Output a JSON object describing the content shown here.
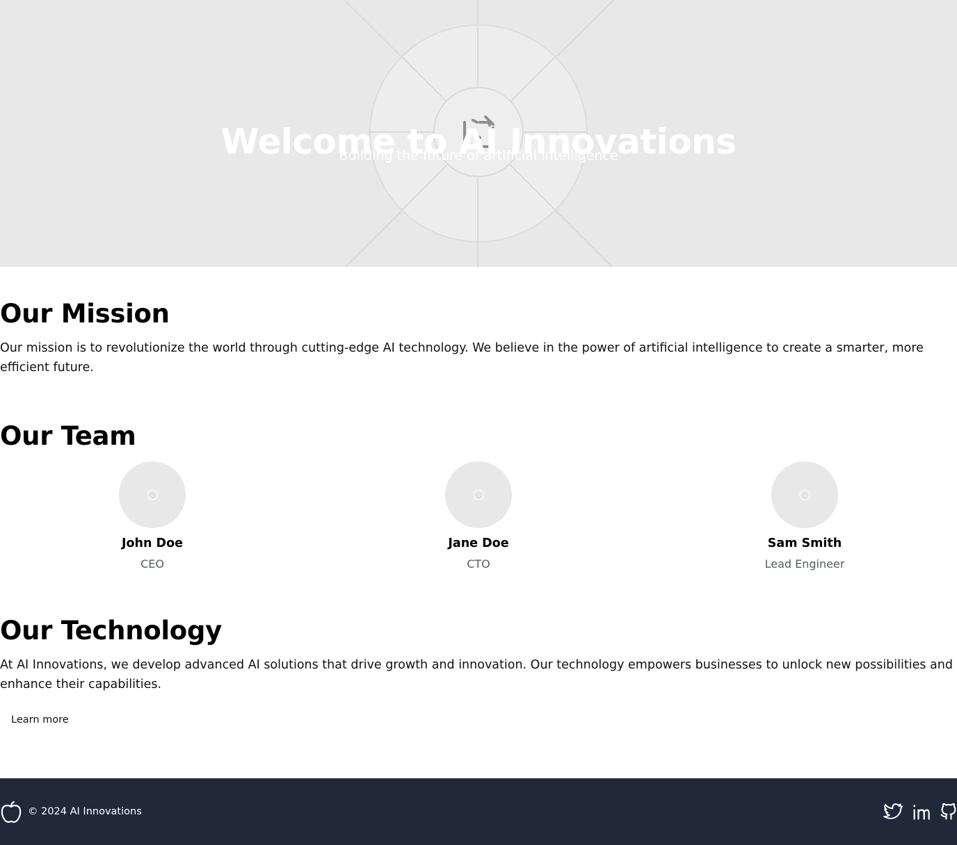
{
  "hero": {
    "title": "Welcome to AI Innovations",
    "subtitle": "Building the future of artificial intelligence",
    "background_icon": "image-placeholder-icon"
  },
  "mission": {
    "heading": "Our Mission",
    "text": "Our mission is to revolutionize the world through cutting-edge AI technology. We believe in the power of artificial intelligence to create a smarter, more efficient future."
  },
  "team": {
    "heading": "Our Team",
    "members": [
      {
        "name": "John Doe",
        "role": "CEO"
      },
      {
        "name": "Jane Doe",
        "role": "CTO"
      },
      {
        "name": "Sam Smith",
        "role": "Lead Engineer"
      }
    ]
  },
  "technology": {
    "heading": "Our Technology",
    "text": "At AI Innovations, we develop advanced AI solutions that drive growth and innovation. Our technology empowers businesses to unlock new possibilities and enhance their capabilities.",
    "button_label": "Learn more"
  },
  "footer": {
    "copyright": "© 2024 AI Innovations",
    "logo_icon": "apple-logo-icon",
    "social_icons": [
      "twitter-icon",
      "linkedin-icon",
      "github-icon"
    ]
  },
  "colors": {
    "hero_bg": "#e8e8e8",
    "footer_bg": "#202938",
    "role_text": "#555b66"
  }
}
